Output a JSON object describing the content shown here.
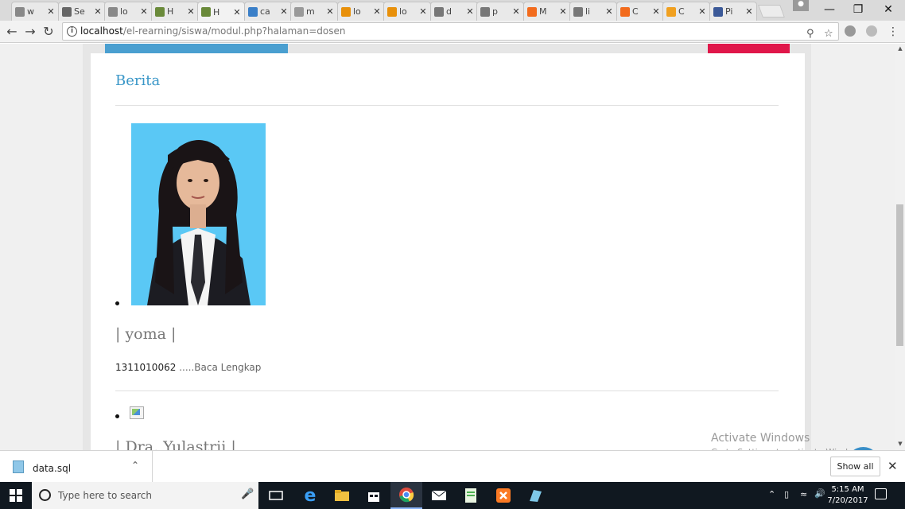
{
  "browser": {
    "tabs": [
      {
        "label": "w",
        "icon": "page-icon",
        "color": "#888888"
      },
      {
        "label": "Se",
        "icon": "gear-icon",
        "color": "#666666"
      },
      {
        "label": "lo",
        "icon": "page-icon",
        "color": "#888888"
      },
      {
        "label": "H",
        "icon": "site-logo-icon",
        "color": "#6a8a3a"
      },
      {
        "label": "H",
        "icon": "site-logo-icon",
        "color": "#6a8a3a"
      },
      {
        "label": "ca",
        "icon": "k-icon",
        "color": "#3a7fc8"
      },
      {
        "label": "m",
        "icon": "wym-icon",
        "color": "#999999"
      },
      {
        "label": "lo",
        "icon": "xampp-icon",
        "color": "#e8900a"
      },
      {
        "label": "lo",
        "icon": "xampp-icon",
        "color": "#e8900a"
      },
      {
        "label": "d",
        "icon": "google-icon",
        "color": "#777777"
      },
      {
        "label": "p",
        "icon": "google-icon",
        "color": "#777777"
      },
      {
        "label": "M",
        "icon": "blogger-icon",
        "color": "#f26b1d"
      },
      {
        "label": "li",
        "icon": "google-icon",
        "color": "#777777"
      },
      {
        "label": "C",
        "icon": "blogger-icon",
        "color": "#f26b1d"
      },
      {
        "label": "C",
        "icon": "u-icon",
        "color": "#f0a020"
      },
      {
        "label": "Pi",
        "icon": "facebook-icon",
        "color": "#3b5998"
      }
    ],
    "active_tab_index": 4,
    "url_host": "localhost",
    "url_path": "/el-rearning/siswa/modul.php?halaman=dosen"
  },
  "page": {
    "section_title": "Berita",
    "entries": [
      {
        "name": "| yoma |",
        "id": "1311010062",
        "more": ".....Baca Lengkap"
      },
      {
        "name": "| Dra. Yulastrii |"
      }
    ]
  },
  "overlay": {
    "activate_title": "Activate Windows",
    "activate_sub": "Go to Settings to activate Windows."
  },
  "downloads": {
    "file": "data.sql",
    "show_all": "Show all"
  },
  "taskbar": {
    "search_placeholder": "Type here to search",
    "time": "5:15 AM",
    "date": "7/20/2017"
  },
  "colors": {
    "accent_blue": "#3a97c8",
    "accent_red": "#e0174a",
    "photo_bg": "#5ac8f5"
  }
}
